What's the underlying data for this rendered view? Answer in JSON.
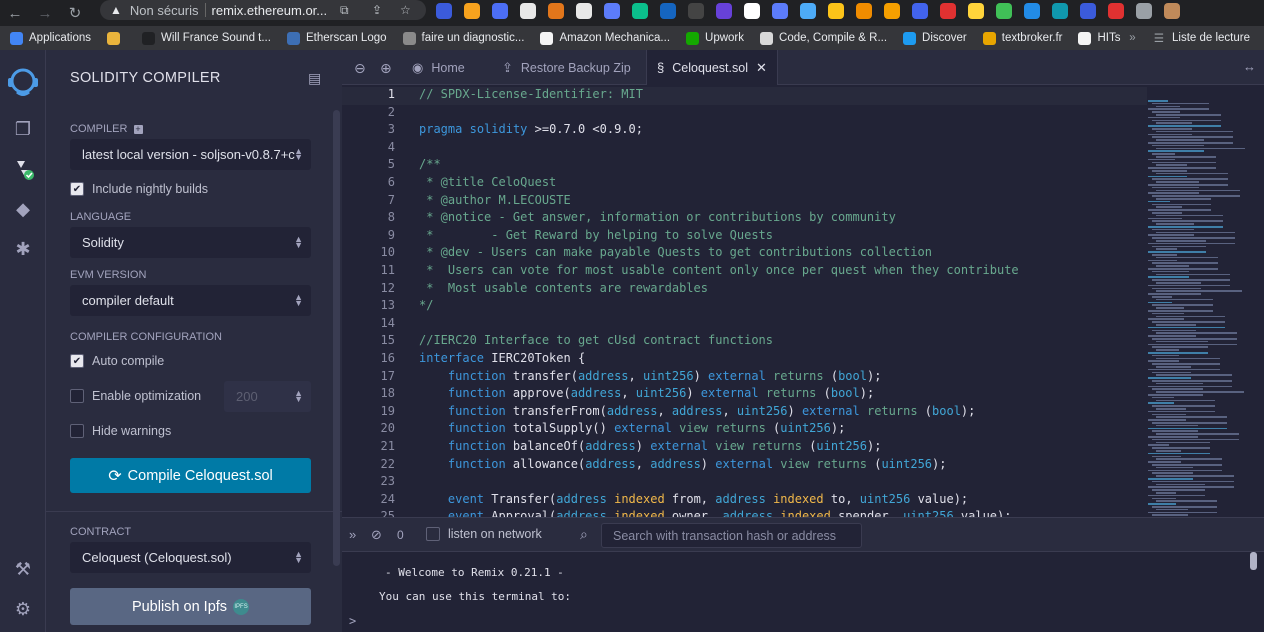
{
  "browser": {
    "security_label": "Non sécuris",
    "url_host": "remix.ethereum.or...",
    "bookmarks": [
      {
        "label": "Applications",
        "color": "#4285f4"
      },
      {
        "label": "",
        "color": "#e9b43c"
      },
      {
        "label": "Will France Sound t...",
        "color": "#202124"
      },
      {
        "label": "Etherscan Logo",
        "color": "#3d6fb4"
      },
      {
        "label": "faire un diagnostic...",
        "color": "#8a8a8a"
      },
      {
        "label": "Amazon Mechanica...",
        "color": "#f4f4f4"
      },
      {
        "label": "Upwork",
        "color": "#14a800"
      },
      {
        "label": "Code, Compile & R...",
        "color": "#d8d8d8"
      },
      {
        "label": "Discover",
        "color": "#1d9bf0"
      },
      {
        "label": "textbroker.fr",
        "color": "#e8a600"
      },
      {
        "label": "HITs",
        "color": "#f4f4f4"
      }
    ],
    "more": "»",
    "reading_list": "Liste de lecture"
  },
  "sidebar": {
    "title": "SOLIDITY COMPILER",
    "compiler_label": "COMPILER",
    "compiler_value": "latest local version - soljson-v0.8.7+c",
    "nightly_label": "Include nightly builds",
    "nightly_checked": true,
    "language_label": "LANGUAGE",
    "language_value": "Solidity",
    "evm_label": "EVM VERSION",
    "evm_value": "compiler default",
    "config_label": "COMPILER CONFIGURATION",
    "auto_compile_label": "Auto compile",
    "auto_compile_checked": true,
    "optimization_label": "Enable optimization",
    "optimization_runs": "200",
    "hide_warnings_label": "Hide warnings",
    "compile_button": "Compile Celoquest.sol",
    "contract_label": "CONTRACT",
    "contract_value": "Celoquest (Celoquest.sol)",
    "publish_button": "Publish on Ipfs",
    "ipfs_badge": "IPFS"
  },
  "editor": {
    "tabs": [
      {
        "label": "Home",
        "icon": "remix-home-icon"
      },
      {
        "label": "Restore Backup Zip",
        "icon": "upload-icon"
      },
      {
        "label": "Celoquest.sol",
        "icon": "solidity-file-icon",
        "active": true
      }
    ],
    "lines": [
      {
        "n": "1",
        "t": "// SPDX-License-Identifier: MIT"
      },
      {
        "n": "2",
        "t": ""
      },
      {
        "n": "3",
        "t": "pragma solidity >=0.7.0 <0.9.0;"
      },
      {
        "n": "4",
        "t": ""
      },
      {
        "n": "5",
        "t": "/**"
      },
      {
        "n": "6",
        "t": " * @title CeloQuest"
      },
      {
        "n": "7",
        "t": " * @author M.LECOUSTE"
      },
      {
        "n": "8",
        "t": " * @notice - Get answer, information or contributions by community"
      },
      {
        "n": "9",
        "t": " *        - Get Reward by helping to solve Quests"
      },
      {
        "n": "10",
        "t": " * @dev - Users can make payable Quests to get contributions collection"
      },
      {
        "n": "11",
        "t": " *  Users can vote for most usable content only once per quest when they contribute"
      },
      {
        "n": "12",
        "t": " *  Most usable contents are rewardables"
      },
      {
        "n": "13",
        "t": "*/"
      },
      {
        "n": "14",
        "t": ""
      },
      {
        "n": "15",
        "t": "//IERC20 Interface to get cUsd contract functions"
      },
      {
        "n": "16",
        "t": "interface IERC20Token {"
      },
      {
        "n": "17",
        "t": "    function transfer(address, uint256) external returns (bool);"
      },
      {
        "n": "18",
        "t": "    function approve(address, uint256) external returns (bool);"
      },
      {
        "n": "19",
        "t": "    function transferFrom(address, address, uint256) external returns (bool);"
      },
      {
        "n": "20",
        "t": "    function totalSupply() external view returns (uint256);"
      },
      {
        "n": "21",
        "t": "    function balanceOf(address) external view returns (uint256);"
      },
      {
        "n": "22",
        "t": "    function allowance(address, address) external view returns (uint256);"
      },
      {
        "n": "23",
        "t": ""
      },
      {
        "n": "24",
        "t": "    event Transfer(address indexed from, address indexed to, uint256 value);"
      },
      {
        "n": "25",
        "t": "    event Approval(address indexed owner, address indexed spender, uint256 value);"
      }
    ]
  },
  "terminal": {
    "pending_count": "0",
    "listen_label": "listen on network",
    "search_placeholder": "Search with transaction hash or address",
    "welcome": "- Welcome to Remix 0.21.1 -",
    "intro": "You can use this terminal to:",
    "prompt": ">"
  }
}
